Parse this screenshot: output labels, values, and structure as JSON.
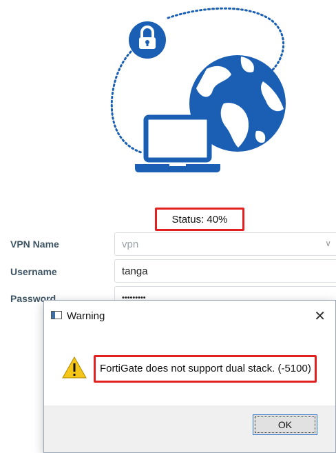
{
  "status": {
    "text": "Status: 40%",
    "progress_percent": 40
  },
  "form": {
    "vpn_name": {
      "label": "VPN Name",
      "value": "vpn"
    },
    "username": {
      "label": "Username",
      "value": "tanga"
    },
    "password": {
      "label": "Password",
      "value": "•••••••••"
    }
  },
  "dialog": {
    "title": "Warning",
    "message": "FortiGate does not support dual stack. (-5100)",
    "ok_label": "OK",
    "close_glyph": "✕"
  },
  "colors": {
    "brand_blue": "#1a5fb4",
    "highlight_red": "#e32020",
    "warning_yellow": "#f5c518"
  },
  "icons": [
    "lock-icon",
    "globe-icon",
    "laptop-icon",
    "warning-icon",
    "chevron-down-icon",
    "close-icon"
  ]
}
